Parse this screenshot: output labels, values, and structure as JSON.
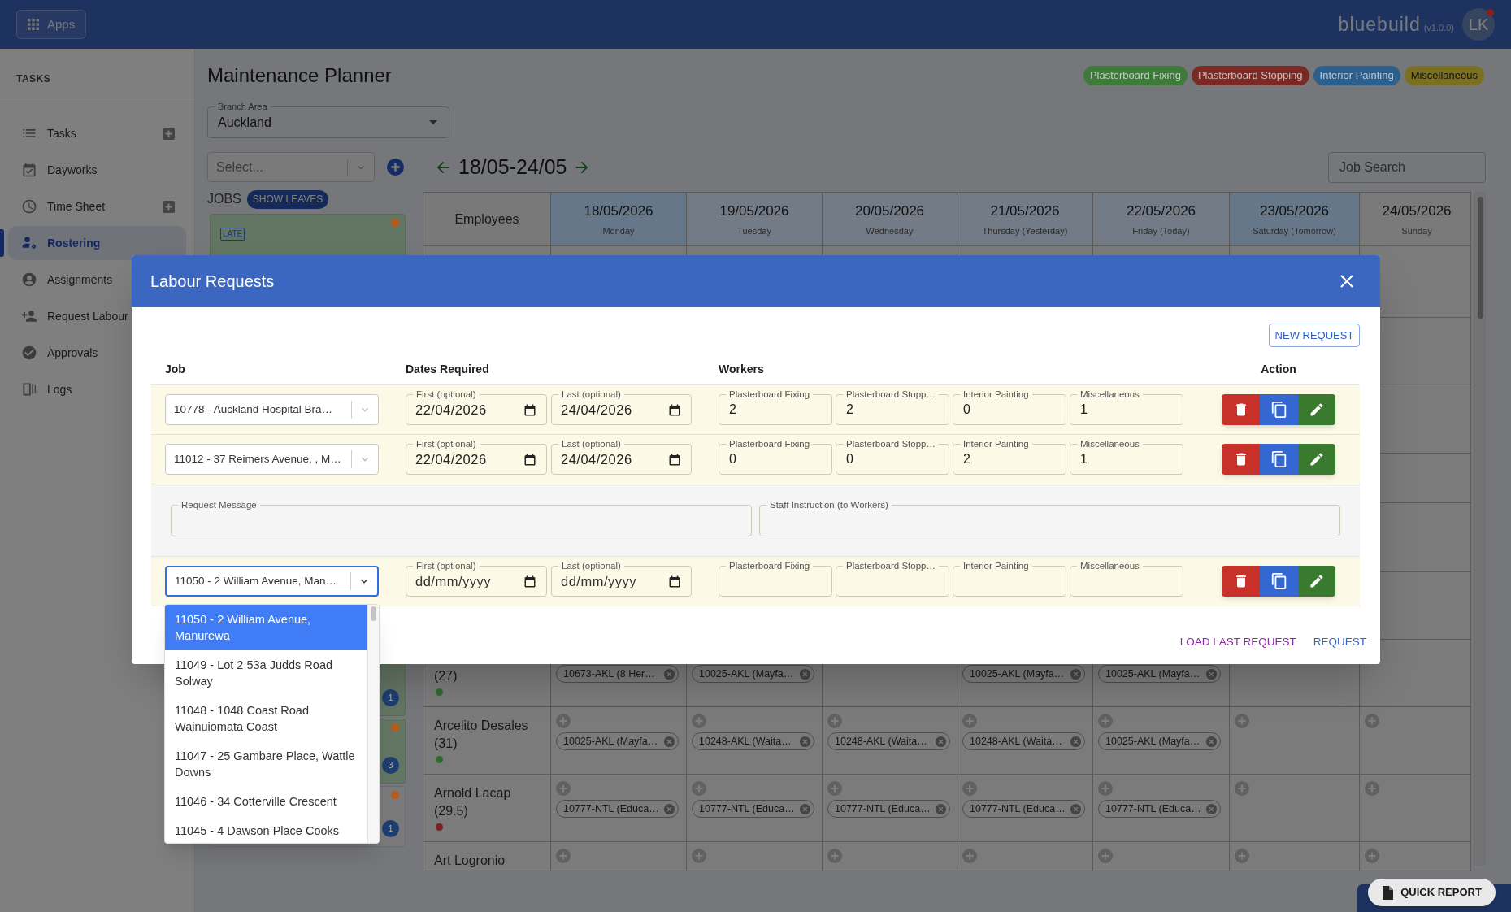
{
  "app_bar": {
    "apps_label": "Apps",
    "brand": "bluebuild",
    "version": "(v1.0.0)",
    "avatar": "LK",
    "notification": true
  },
  "sidebar": {
    "heading": "TASKS",
    "items": [
      {
        "label": "Tasks",
        "selected": false,
        "addable": true
      },
      {
        "label": "Dayworks",
        "selected": false,
        "addable": false
      },
      {
        "label": "Time Sheet",
        "selected": false,
        "addable": true
      },
      {
        "label": "Rostering",
        "selected": true,
        "addable": false
      },
      {
        "label": "Assignments",
        "selected": false,
        "addable": false
      },
      {
        "label": "Request Labour",
        "selected": false,
        "addable": false
      },
      {
        "label": "Approvals",
        "selected": false,
        "addable": false
      },
      {
        "label": "Logs",
        "selected": false,
        "addable": false
      }
    ]
  },
  "planner": {
    "title": "Maintenance Planner",
    "legend": [
      {
        "label": "Plasterboard Fixing",
        "color": "#3e7a3a"
      },
      {
        "label": "Plasterboard Stopping",
        "color": "#7a2a24"
      },
      {
        "label": "Interior Painting",
        "color": "#2d5f8c"
      },
      {
        "label": "Miscellaneous",
        "color": "#7a7020"
      }
    ],
    "branch_area": {
      "label": "Branch Area",
      "value": "Auckland"
    },
    "job_select": {
      "placeholder": "Select..."
    },
    "jobs_heading": "JOBS",
    "show_leaves": "SHOW LEAVES",
    "job_cards": [
      {
        "late": "LATE",
        "dot": true,
        "color": "#637563"
      },
      {
        "count": "1",
        "color": "#637563"
      },
      {
        "count": "3",
        "dot": true,
        "color": "#637563"
      },
      {
        "count": "1",
        "dot": true,
        "color": "#7a7a7a"
      }
    ],
    "week": "18/05-24/05",
    "job_search": {
      "placeholder": "Job Search"
    }
  },
  "roster": {
    "employee_heading": "Employees",
    "days": [
      {
        "date": "18/05/2026",
        "weekday": "Monday",
        "color": "#67778a"
      },
      {
        "date": "19/05/2026",
        "weekday": "Tuesday",
        "color": "#737b87"
      },
      {
        "date": "20/05/2026",
        "weekday": "Wednesday",
        "color": "#737b87"
      },
      {
        "date": "21/05/2026",
        "weekday": "Thursday (Yesterday)",
        "color": "#737b87"
      },
      {
        "date": "22/05/2026",
        "weekday": "Friday (Today)",
        "color": "#737b87"
      },
      {
        "date": "23/05/2026",
        "weekday": "Saturday (Tomorrow)",
        "color": "#67778a"
      },
      {
        "date": "24/05/2026",
        "weekday": "Sunday",
        "color": "#7a7a7a"
      }
    ],
    "rows": [
      {
        "hours": "(27)",
        "color": "#2e6a2e",
        "cells": [
          {
            "chip": "10673-AKL (8 Her…"
          },
          {
            "chip": "10025-AKL (Mayfa…"
          },
          {},
          {
            "chip": "10025-AKL (Mayfa…"
          },
          {
            "chip": "10025-AKL (Mayfa…"
          },
          {},
          {}
        ]
      },
      {
        "name": "Arcelito Desales",
        "hours": "(31)",
        "color": "#2e6a2e",
        "cells": [
          {
            "chip": "10025-AKL (Mayfa…"
          },
          {
            "chip": "10248-AKL (Waita…"
          },
          {
            "chip": "10248-AKL (Waita…"
          },
          {
            "chip": "10248-AKL (Waita…"
          },
          {
            "chip": "10025-AKL (Mayfa…"
          },
          {},
          {}
        ]
      },
      {
        "name": "Arnold Lacap",
        "hours": "(29.5)",
        "color": "#7a2020",
        "cells": [
          {
            "chip": "10777-NTL (Educa…"
          },
          {
            "chip": "10777-NTL (Educa…"
          },
          {
            "chip": "10777-NTL (Educa…"
          },
          {
            "chip": "10777-NTL (Educa…"
          },
          {
            "chip": "10777-NTL (Educa…"
          },
          {},
          {}
        ]
      },
      {
        "name": "Art Logronio",
        "cells": [
          {},
          {},
          {},
          {},
          {},
          {},
          {}
        ]
      }
    ]
  },
  "labour_requests": {
    "title": "Labour Requests",
    "new_request": "NEW REQUEST",
    "headers": [
      "Job",
      "Dates Required",
      "Workers",
      "Action"
    ],
    "sections": [
      {
        "kind": "request",
        "job": "10778 - Auckland Hospital Bra…",
        "focused": false,
        "first": {
          "label": "First (optional)",
          "value": "22/04/2026"
        },
        "last": {
          "label": "Last (optional)",
          "value": "24/04/2026"
        },
        "workers": [
          {
            "label": "Plasterboard Fixing",
            "value": "2"
          },
          {
            "label": "Plasterboard Stopp…",
            "value": "2"
          },
          {
            "label": "Interior Painting",
            "value": "0"
          },
          {
            "label": "Miscellaneous",
            "value": "1"
          }
        ]
      },
      {
        "kind": "request",
        "job": "11012 - 37 Reimers Avenue, , M…",
        "focused": false,
        "first": {
          "label": "First (optional)",
          "value": "22/04/2026"
        },
        "last": {
          "label": "Last (optional)",
          "value": "24/04/2026"
        },
        "workers": [
          {
            "label": "Plasterboard Fixing",
            "value": "0"
          },
          {
            "label": "Plasterboard Stopp…",
            "value": "0"
          },
          {
            "label": "Interior Painting",
            "value": "2"
          },
          {
            "label": "Miscellaneous",
            "value": "1"
          }
        ]
      },
      {
        "kind": "messages",
        "fields": [
          {
            "label": "Request Message"
          },
          {
            "label": "Staff Instruction (to Workers)"
          }
        ]
      },
      {
        "kind": "request",
        "job": "11050 - 2 William Avenue, Man…",
        "focused": true,
        "first": {
          "label": "First (optional)",
          "placeholder": "dd/mm/yyyy"
        },
        "last": {
          "label": "Last (optional)",
          "placeholder": "dd/mm/yyyy"
        },
        "workers": [
          {
            "label": "Plasterboard Fixing"
          },
          {
            "label": "Plasterboard Stopp…"
          },
          {
            "label": "Interior Painting"
          },
          {
            "label": "Miscellaneous"
          }
        ],
        "options": [
          {
            "label": "11050 - 2 William Avenue, Manurewa",
            "selected": true
          },
          {
            "label": "11049 - Lot 2 53a Judds Road Solway",
            "selected": false
          },
          {
            "label": "11048 - 1048 Coast Road Wainuiomata Coast",
            "selected": false
          },
          {
            "label": "11047 - 25 Gambare Place, Wattle Downs",
            "selected": false
          },
          {
            "label": "11046 - 34 Cotterville Crescent",
            "selected": false
          },
          {
            "label": "11045 - 4 Dawson Place Cooks",
            "selected": false
          }
        ]
      }
    ],
    "links": [
      {
        "label": "LOAD LAST REQUEST",
        "color": "#8e24aa"
      },
      {
        "label": "REQUEST",
        "color": "#2f66d0"
      }
    ]
  },
  "quick_report": "QUICK REPORT"
}
